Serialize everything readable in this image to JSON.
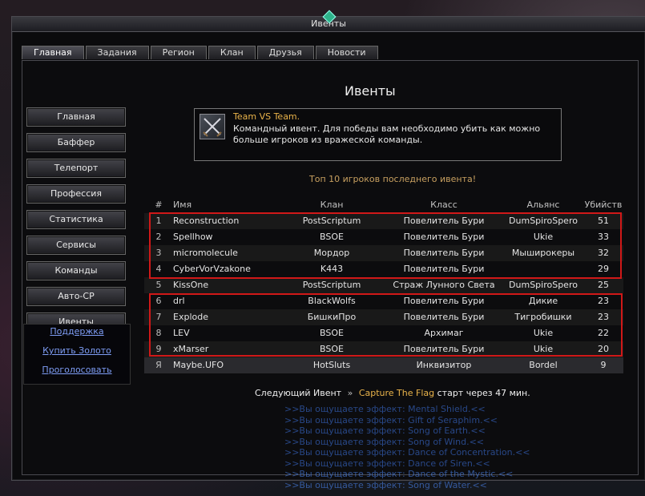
{
  "window": {
    "title": "Ивенты"
  },
  "tabs": [
    "Главная",
    "Задания",
    "Регион",
    "Клан",
    "Друзья",
    "Новости"
  ],
  "heading": "Ивенты",
  "menu": [
    "Главная",
    "Баффер",
    "Телепорт",
    "Профессия",
    "Статистика",
    "Сервисы",
    "Команды",
    "Авто-CP",
    "Ивенты"
  ],
  "links": [
    "Поддержка",
    "Купить Золото",
    "Проголосовать"
  ],
  "event_info": {
    "title": "Team VS Team.",
    "text": " Командный ивент. Для победы вам необходимо убить как можно больше игроков из вражеской команды."
  },
  "top10_caption": "Топ 10 игроков последнего ивента!",
  "table": {
    "headers": [
      "#",
      "Имя",
      "Клан",
      "Класс",
      "Альянс",
      "Убийств"
    ],
    "rows": [
      [
        "1",
        "Reconstruction",
        "PostScriptum",
        "Повелитель Бури",
        "DumSpiroSpero",
        "51"
      ],
      [
        "2",
        "Spellhow",
        "BSOE",
        "Повелитель Бури",
        "Ukie",
        "33"
      ],
      [
        "3",
        "micromolecule",
        "Мордор",
        "Повелитель Бури",
        "Мыширокеры",
        "32"
      ],
      [
        "4",
        "CyberVorVzakone",
        "K443",
        "Повелитель Бури",
        "",
        "29"
      ],
      [
        "5",
        "KissOne",
        "PostScriptum",
        "Страж Лунного Света",
        "DumSpiroSpero",
        "25"
      ],
      [
        "6",
        "drl",
        "BlackWolfs",
        "Повелитель Бури",
        "Дикие",
        "23"
      ],
      [
        "7",
        "Explode",
        "БишкиПро",
        "Повелитель Бури",
        "Тигробишки",
        "23"
      ],
      [
        "8",
        "LEV",
        "BSOE",
        "Архимаг",
        "Ukie",
        "22"
      ],
      [
        "9",
        "xMarser",
        "BSOE",
        "Повелитель Бури",
        "Ukie",
        "20"
      ]
    ],
    "me": [
      "Я",
      "Maybe.UFO",
      "HotSluts",
      "Инквизитор",
      "Bordel",
      "9"
    ]
  },
  "next_event": {
    "prefix": "Следующий Ивент",
    "arrow": "»",
    "name": "Capture The Flag",
    "suffix": "старт через 47 мин."
  },
  "chat": [
    ">>Вы ощущаете эффект: Mental Shield.<<",
    ">>Вы ощущаете эффект: Gift of Seraphim.<<",
    ">>Вы ощущаете эффект: Song of Earth.<<",
    ">>Вы ощущаете эффект: Song of Wind.<<",
    ">>Вы ощущаете эффект: Dance of Concentration.<<",
    ">>Вы ощущаете эффект: Dance of Siren.<<",
    ">>Вы ощущаете эффект: Dance of the Mystic.<<",
    ">>Вы ощущаете эффект: Song of Water.<<"
  ],
  "colors": {
    "highlight_box": "#d01818",
    "event_title": "#e9b34a",
    "link": "#7e9df5"
  }
}
